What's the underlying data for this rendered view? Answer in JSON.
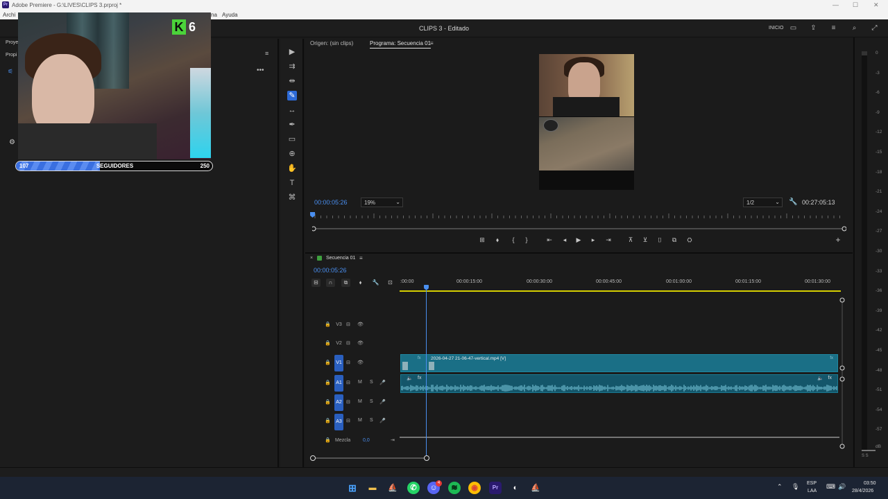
{
  "window": {
    "title": "Adobe Premiere - G:\\LIVES\\CLIPS 3.prproj *",
    "app_logo": "Pr"
  },
  "menu": {
    "items": [
      "Archi",
      "na",
      "Ayuda"
    ]
  },
  "header": {
    "title": "CLIPS 3 - Editado",
    "inicio": "INICIO"
  },
  "left_panel": {
    "tab_project": "Proye",
    "tab_props": "Propi"
  },
  "overlay": {
    "k_letter": "K",
    "k_count": "6",
    "followers_current": "107",
    "followers_label": "SEGUIDORES",
    "followers_goal": "250",
    "followers_progress": 0.428
  },
  "program_monitor": {
    "source_tab": "Origen: (sin clips)",
    "program_tab": "Programa: Secuencia 01",
    "current_time": "00:00:05:26",
    "zoom": "19%",
    "resolution": "1/2",
    "duration": "00:27:05:13"
  },
  "timeline": {
    "sequence_name": "Secuencia 01",
    "current_time": "00:00:05:26",
    "ticks": [
      ":00:00",
      "00:00:15:00",
      "00:00:30:00",
      "00:00:45:00",
      "00:01:00:00",
      "00:01:15:00",
      "00:01:30:00"
    ],
    "tracks": {
      "v3": "V3",
      "v2": "V2",
      "v1": "V1",
      "a1": "A1",
      "a2": "A2",
      "a3": "A3",
      "mix_label": "Mezcla",
      "mix_value": "0,0",
      "m": "M",
      "s": "S"
    },
    "clip_name": "2026-04-27 21-06-47-vertical.mp4 [V]",
    "fx": "fx"
  },
  "meters": {
    "ticks": [
      "0",
      "-3",
      "-6",
      "-9",
      "-12",
      "-15",
      "-18",
      "-21",
      "-24",
      "-27",
      "-30",
      "-33",
      "-36",
      "-39",
      "-42",
      "-45",
      "-48",
      "-51",
      "-54",
      "-57"
    ],
    "db_label": "dB",
    "ss_label": "S S"
  },
  "taskbar": {
    "lang1": "ESP",
    "lang2": "LAA",
    "time": "03:50",
    "date": "28/4/2026",
    "discord_badge": "4"
  },
  "colors": {
    "accent": "#4a8ff0",
    "clip_video": "#1a6f86",
    "clip_audio": "#14566a",
    "active_tool": "#2d6ad6"
  }
}
